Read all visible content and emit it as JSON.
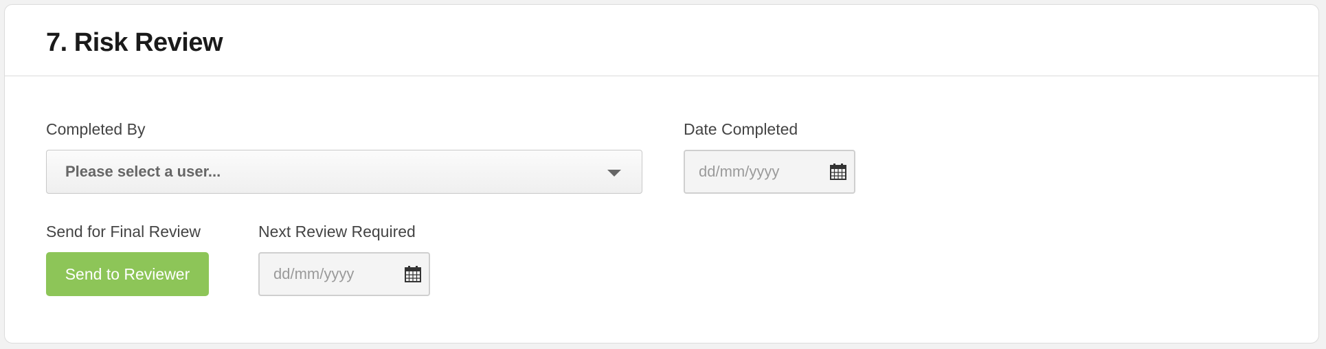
{
  "section": {
    "title": "7. Risk Review"
  },
  "completed_by": {
    "label": "Completed By",
    "selected_value": "Please select a user..."
  },
  "date_completed": {
    "label": "Date Completed",
    "placeholder": "dd/mm/yyyy",
    "value": ""
  },
  "final_review": {
    "label": "Send for Final Review",
    "button_label": "Send to Reviewer"
  },
  "next_review": {
    "label": "Next Review Required",
    "placeholder": "dd/mm/yyyy",
    "value": ""
  },
  "icons": {
    "select_caret": "caret-down-icon",
    "date_picker": "calendar-icon"
  },
  "colors": {
    "accent_button": "#8dc558",
    "heading": "#1a1a1a",
    "label": "#444444"
  }
}
